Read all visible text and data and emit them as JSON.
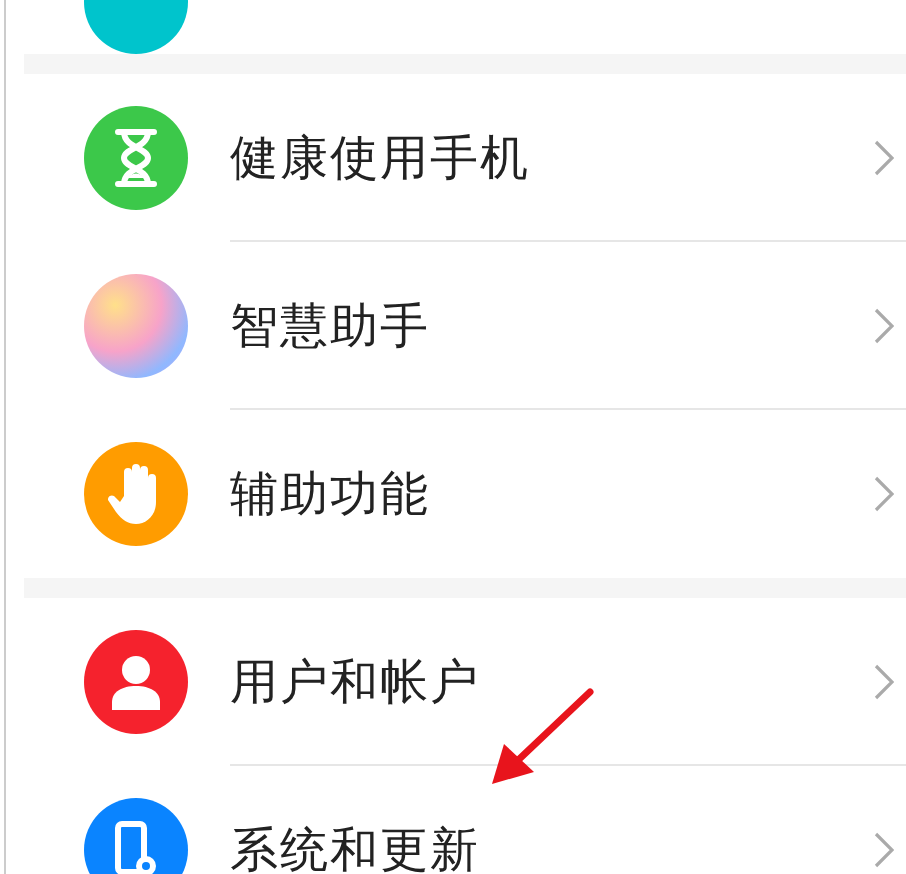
{
  "top_item": {
    "color": "#00c4cc"
  },
  "sections": [
    {
      "items": [
        {
          "label": "健康使用手机",
          "color": "#3cc84a"
        },
        {
          "label": "智慧助手"
        },
        {
          "label": "辅助功能",
          "color": "#ff9c00"
        }
      ]
    },
    {
      "items": [
        {
          "label": "用户和帐户",
          "color": "#f5222d"
        },
        {
          "label": "系统和更新",
          "color": "#0a84ff"
        }
      ]
    }
  ]
}
